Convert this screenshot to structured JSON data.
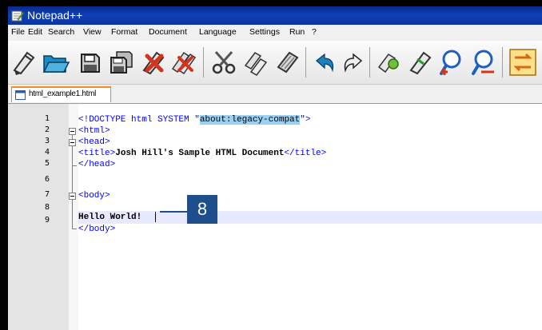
{
  "window": {
    "title": "Notepad++"
  },
  "menu": [
    "File",
    "Edit",
    "Search",
    "View",
    "Format",
    "Document",
    "Language",
    "Settings",
    "Run",
    "?"
  ],
  "tab": {
    "label": "html_example1.html"
  },
  "editor": {
    "line_numbers": [
      "1",
      "2",
      "3",
      "4",
      "5",
      "6",
      "7",
      "8",
      "9"
    ],
    "lines": {
      "l1_a": "<!DOCTYPE html SYSTEM \"",
      "l1_b": "about:legacy-compat",
      "l1_c": "\">",
      "l2": "<html>",
      "l3": "<head>",
      "l4_open": "<title>",
      "l4_text": "Josh Hill's Sample HTML Document",
      "l4_close": "</title>",
      "l5": "</head>",
      "l7": "<body>",
      "l8": "Hello World!",
      "l9": "</body>"
    }
  },
  "callout": {
    "number": "8"
  },
  "colors": {
    "tag": "#0000ff",
    "highlight": "#9ad0f2",
    "callout": "#1f4e8c",
    "titlebar": "#0f3fb8"
  }
}
